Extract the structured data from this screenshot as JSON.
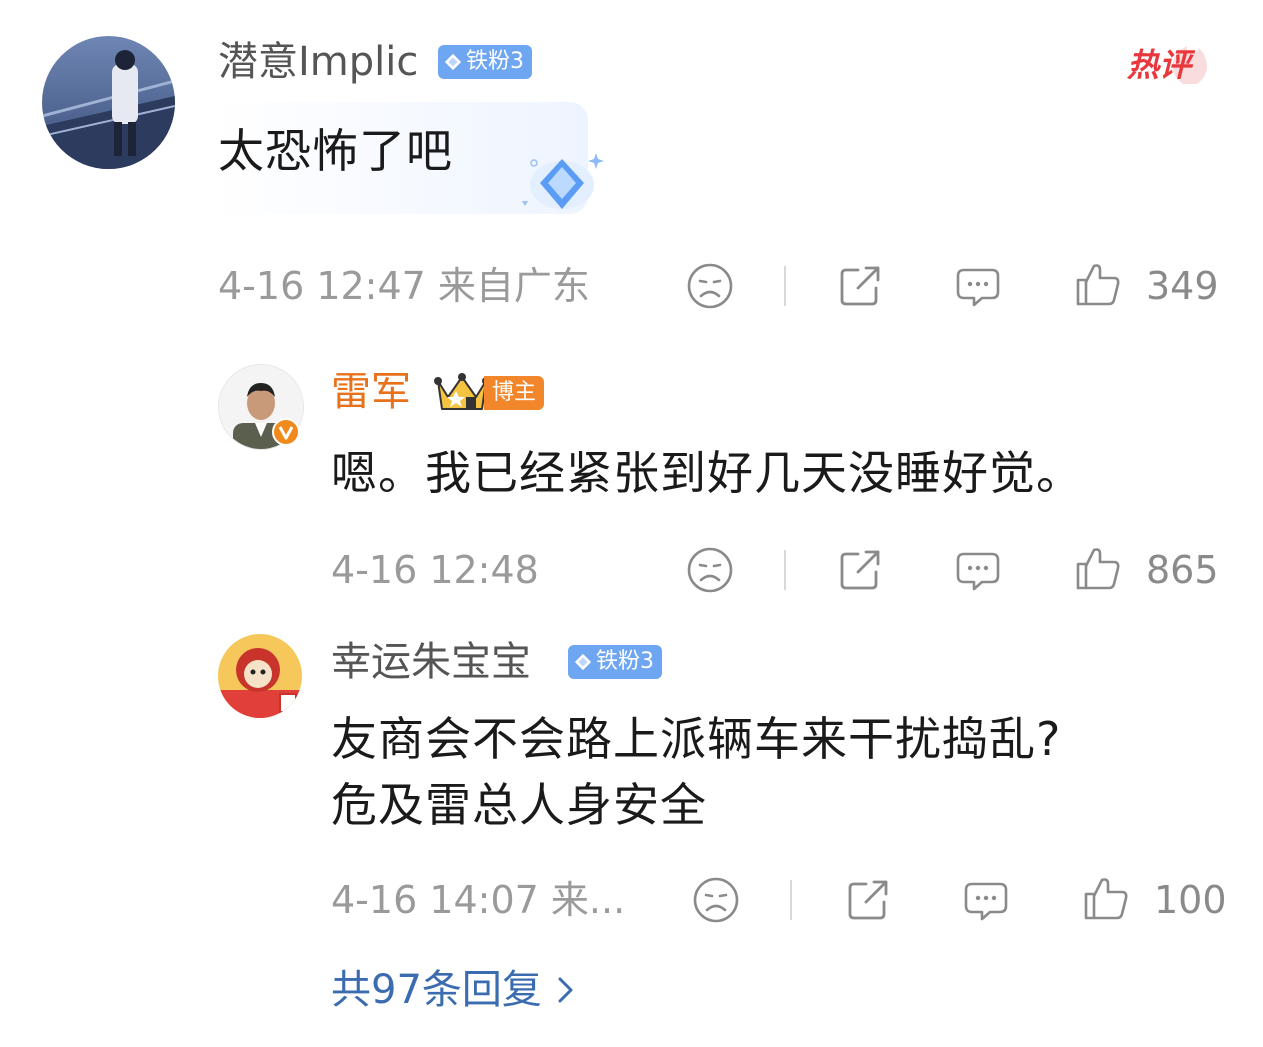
{
  "comment": {
    "username": "潜意Implic",
    "fan_badge": "铁粉3",
    "hot_label": "热评",
    "text": "太恐怖了吧",
    "meta": "4-16 12:47 来自广东",
    "likes": "349"
  },
  "replies": [
    {
      "username": "雷军",
      "role_badge": "博主",
      "text": "嗯。我已经紧张到好几天没睡好觉。",
      "meta": "4-16 12:48",
      "likes": "865"
    },
    {
      "username": "幸运朱宝宝",
      "fan_badge": "铁粉3",
      "text_line1": "友商会不会路上派辆车来干扰捣乱?",
      "text_line2": "危及雷总人身安全",
      "meta": "4-16 14:07 来...",
      "likes": "100"
    }
  ],
  "more_replies": "共97条回复",
  "colors": {
    "accent_orange": "#e8711c",
    "link_blue": "#3c6cb0",
    "fan_badge_blue": "#6fa6f2",
    "hot_red": "#e8383d",
    "meta_gray": "#9a9a9a"
  }
}
